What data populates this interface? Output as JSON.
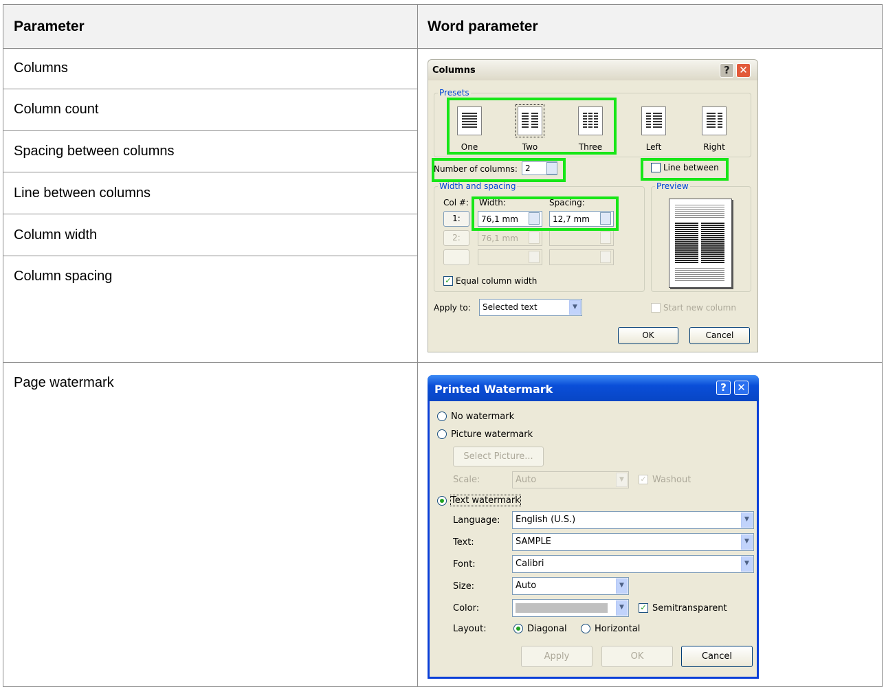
{
  "table": {
    "header": {
      "col1": "Parameter",
      "col2": "Word parameter"
    },
    "rows": [
      "Columns",
      "Column count",
      "Spacing between columns",
      "Line between columns",
      "Column width",
      "Column spacing",
      "Page watermark"
    ]
  },
  "columns_dialog": {
    "title": "Columns",
    "help_icon": "?",
    "close_icon": "✕",
    "presets_label": "Presets",
    "presets": [
      {
        "label": "One",
        "icon": "one-column-icon"
      },
      {
        "label": "Two",
        "icon": "two-columns-icon"
      },
      {
        "label": "Three",
        "icon": "three-columns-icon"
      },
      {
        "label": "Left",
        "icon": "left-columns-icon"
      },
      {
        "label": "Right",
        "icon": "right-columns-icon"
      }
    ],
    "num_columns_label": "Number of columns:",
    "num_columns_value": "2",
    "line_between_label": "Line between",
    "width_spacing_label": "Width and spacing",
    "col_header": "Col #:",
    "width_header": "Width:",
    "spacing_header": "Spacing:",
    "rows": [
      {
        "num": "1:",
        "width": "76,1 mm",
        "spacing": "12,7 mm"
      },
      {
        "num": "2:",
        "width": "76,1 mm",
        "spacing": ""
      }
    ],
    "equal_width_label": "Equal column width",
    "preview_label": "Preview",
    "apply_to_label": "Apply to:",
    "apply_to_value": "Selected text",
    "start_new_column_label": "Start new column",
    "ok_label": "OK",
    "cancel_label": "Cancel",
    "colors": {
      "title_bar": "#ece9d8",
      "highlight": "#17e617"
    }
  },
  "watermark_dialog": {
    "title": "Printed Watermark",
    "help_icon": "?",
    "close_icon": "✕",
    "no_watermark": "No watermark",
    "picture_watermark": "Picture watermark",
    "select_picture": "Select Picture...",
    "scale_label": "Scale:",
    "scale_value": "Auto",
    "washout_label": "Washout",
    "text_watermark": "Text watermark",
    "language_label": "Language:",
    "language_value": "English (U.S.)",
    "text_label": "Text:",
    "text_value": "SAMPLE",
    "font_label": "Font:",
    "font_value": "Calibri",
    "size_label": "Size:",
    "size_value": "Auto",
    "color_label": "Color:",
    "semitransparent_label": "Semitransparent",
    "layout_label": "Layout:",
    "diagonal_label": "Diagonal",
    "horizontal_label": "Horizontal",
    "apply_label": "Apply",
    "ok_label": "OK",
    "cancel_label": "Cancel",
    "colors": {
      "title_bar": "#0a3fd8",
      "color_swatch": "#c0c0c0"
    }
  }
}
